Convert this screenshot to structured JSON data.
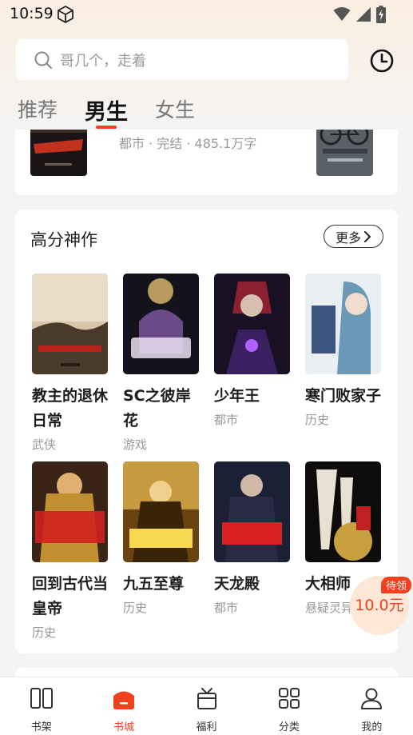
{
  "status_bar": {
    "time": "10:59"
  },
  "search": {
    "placeholder": "哥几个，走着"
  },
  "tabs": [
    {
      "label": "推荐",
      "active": false
    },
    {
      "label": "男生",
      "active": true
    },
    {
      "label": "女生",
      "active": false
    }
  ],
  "previous_card": {
    "meta": "都市 · 完结 · 485.1万字"
  },
  "section": {
    "title": "高分神作",
    "more_label": "更多",
    "books": [
      {
        "title": "教主的退休日常",
        "tag": "武侠"
      },
      {
        "title": "SC之彼岸花",
        "tag": "游戏"
      },
      {
        "title": "少年王",
        "tag": "都市"
      },
      {
        "title": "寒门败家子",
        "tag": "历史"
      },
      {
        "title": "回到古代当皇帝",
        "tag": "历史"
      },
      {
        "title": "九五至尊",
        "tag": "历史"
      },
      {
        "title": "天龙殿",
        "tag": "都市"
      },
      {
        "title": "大相师",
        "tag": "悬疑灵异"
      }
    ]
  },
  "coupon": {
    "badge": "待领",
    "value": "10.0元"
  },
  "bottom_nav": [
    {
      "label": "书架",
      "icon": "bookshelf-icon",
      "active": false
    },
    {
      "label": "书城",
      "icon": "bookstore-icon",
      "active": true
    },
    {
      "label": "福利",
      "icon": "gift-icon",
      "active": false
    },
    {
      "label": "分类",
      "icon": "category-icon",
      "active": false
    },
    {
      "label": "我的",
      "icon": "profile-icon",
      "active": false
    }
  ],
  "colors": {
    "accent": "#f0401e",
    "coupon_bg": "#fde8d8"
  }
}
